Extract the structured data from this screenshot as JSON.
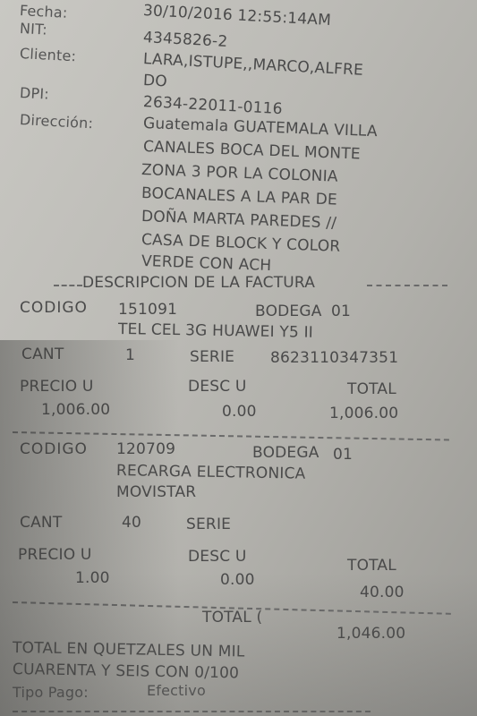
{
  "header": {
    "fecha_label": "Fecha:",
    "fecha_value": "30/10/2016 12:55:14AM",
    "nit_label": "NIT:",
    "nit_value": "4345826-2",
    "cliente_label": "Cliente:",
    "cliente_lines": [
      "LARA,ISTUPE,,MARCO,ALFRE",
      "DO"
    ],
    "dpi_label": "DPI:",
    "dpi_value": "2634-22011-0116",
    "direccion_label": "Dirección:",
    "direccion_lines": [
      "Guatemala GUATEMALA VILLA",
      "CANALES BOCA DEL MONTE",
      "ZONA 3 POR LA COLONIA",
      "BOCANALES A LA PAR DE",
      "DOÑA MARTA PAREDES //",
      "CASA DE BLOCK Y COLOR",
      "VERDE CON ACH"
    ]
  },
  "section_title": "DESCRIPCION DE LA FACTURA",
  "items": [
    {
      "codigo_label": "CODIGO",
      "codigo": "151091",
      "bodega_label": "BODEGA",
      "bodega": "01",
      "description": [
        "TEL CEL 3G HUAWEI Y5 II"
      ],
      "cant_label": "CANT",
      "cant": "1",
      "serie_label": "SERIE",
      "serie": "8623110347351",
      "precio_label": "PRECIO U",
      "precio": "1,006.00",
      "desc_label": "DESC U",
      "desc": "0.00",
      "total_label": "TOTAL",
      "total": "1,006.00"
    },
    {
      "codigo_label": "CODIGO",
      "codigo": "120709",
      "bodega_label": "BODEGA",
      "bodega": "01",
      "description": [
        "RECARGA ELECTRONICA",
        "MOVISTAR"
      ],
      "cant_label": "CANT",
      "cant": "40",
      "serie_label": "SERIE",
      "serie": "",
      "precio_label": "PRECIO U",
      "precio": "1.00",
      "desc_label": "DESC U",
      "desc": "0.00",
      "total_label": "TOTAL",
      "total": "40.00"
    }
  ],
  "footer": {
    "total_label": "TOTAL (",
    "total_value": "1,046.00",
    "words_lines": [
      "TOTAL EN QUETZALES UN  MIL",
      "CUARENTA Y SEIS CON 0/100"
    ],
    "tipo_pago_label": "Tipo Pago:",
    "tipo_pago_value": "Efectivo"
  }
}
